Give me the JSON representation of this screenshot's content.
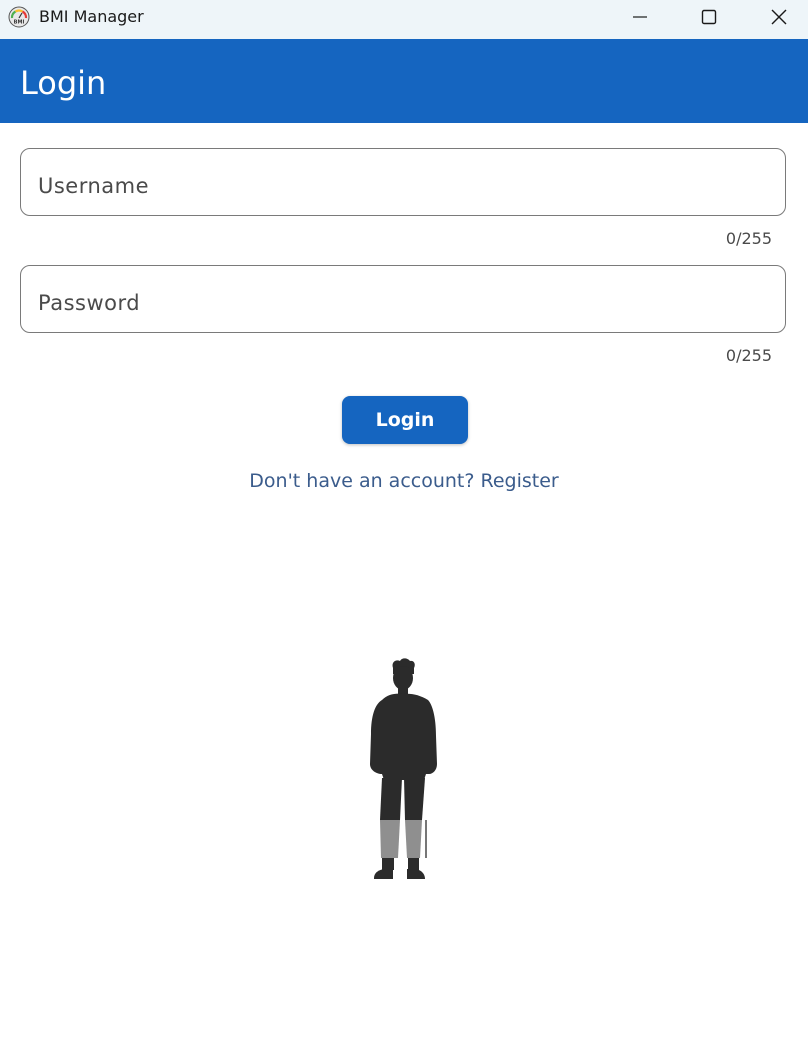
{
  "window": {
    "title": "BMI Manager",
    "icon": "bmi-gauge-icon"
  },
  "appbar": {
    "title": "Login"
  },
  "form": {
    "username": {
      "placeholder": "Username",
      "value": "",
      "counter": "0/255"
    },
    "password": {
      "placeholder": "Password",
      "value": "",
      "counter": "0/255"
    },
    "login_label": "Login",
    "register_link": "Don't have an account? Register"
  },
  "colors": {
    "primary": "#1565c0",
    "link": "#3b5c8c",
    "titlebar": "#eef5f9",
    "figure": "#2b2b2b",
    "figure_highlight": "#8f8f8f"
  }
}
